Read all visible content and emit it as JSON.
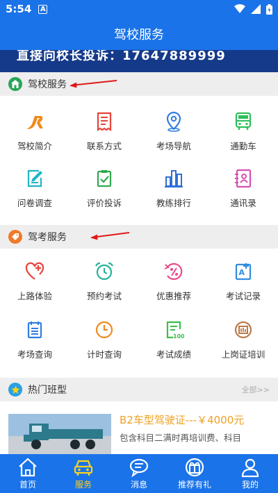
{
  "status_bar": {
    "time": "5:54",
    "nfc_label": "A"
  },
  "header": {
    "title": "驾校服务"
  },
  "banner": {
    "text": "直接向校长投诉：17647889999"
  },
  "section_school": {
    "title": "驾校服务"
  },
  "school_services": [
    {
      "label": "驾校简介",
      "icon": "jr-logo-icon"
    },
    {
      "label": "联系方式",
      "icon": "receipt-icon"
    },
    {
      "label": "考场导航",
      "icon": "location-pin-icon"
    },
    {
      "label": "通勤车",
      "icon": "bus-icon"
    },
    {
      "label": "问卷调查",
      "icon": "edit-form-icon"
    },
    {
      "label": "评价投诉",
      "icon": "clipboard-check-icon"
    },
    {
      "label": "教练排行",
      "icon": "bar-chart-icon"
    },
    {
      "label": "通讯录",
      "icon": "contacts-icon"
    }
  ],
  "section_exam": {
    "title": "驾考服务"
  },
  "exam_services": [
    {
      "label": "上路体验",
      "icon": "heart-plus-icon"
    },
    {
      "label": "预约考试",
      "icon": "alarm-clock-icon"
    },
    {
      "label": "优惠推荐",
      "icon": "discount-icon"
    },
    {
      "label": "考试记录",
      "icon": "score-record-icon"
    },
    {
      "label": "考场查询",
      "icon": "list-icon"
    },
    {
      "label": "计时查询",
      "icon": "clock-icon"
    },
    {
      "label": "考试成绩",
      "icon": "score-sheet-icon"
    },
    {
      "label": "上岗证培训",
      "icon": "certificate-icon"
    }
  ],
  "section_hot": {
    "title": "热门班型",
    "more": "全部>>"
  },
  "hot_card": {
    "title": "B2车型驾驶证---￥4000元",
    "desc": "包含科目二满时再培训费、科目"
  },
  "tabbar": [
    {
      "label": "首页",
      "icon": "home-icon",
      "active": false
    },
    {
      "label": "服务",
      "icon": "car-icon",
      "active": true
    },
    {
      "label": "消息",
      "icon": "chat-bubble-icon",
      "active": false
    },
    {
      "label": "推荐有礼",
      "icon": "gift-icon",
      "active": false
    },
    {
      "label": "我的",
      "icon": "user-icon",
      "active": false
    }
  ],
  "colors": {
    "primary": "#1a73e8",
    "active_tab": "#ffd21a",
    "price": "#f0a020"
  }
}
